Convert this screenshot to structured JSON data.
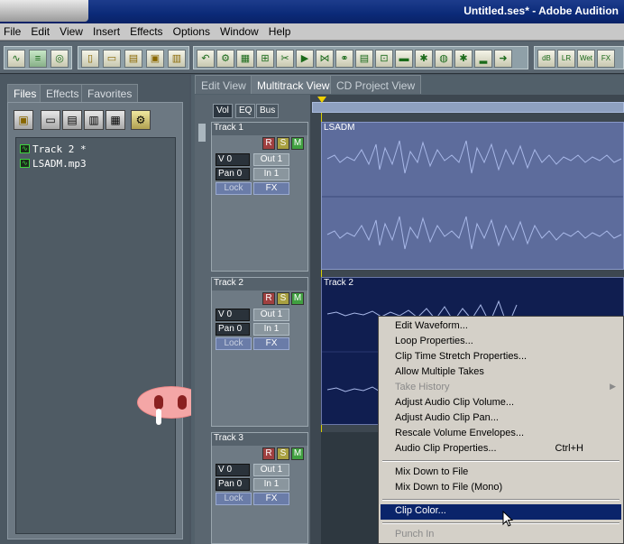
{
  "window": {
    "title": "Untitled.ses* - Adobe Audition"
  },
  "menubar": {
    "items": [
      "File",
      "Edit",
      "View",
      "Insert",
      "Effects",
      "Options",
      "Window",
      "Help"
    ]
  },
  "left_panel": {
    "tabs": [
      "Files",
      "Effects",
      "Favorites"
    ],
    "files": [
      "Track 2 *",
      "LSADM.mp3"
    ]
  },
  "view_tabs": [
    "Edit View",
    "Multitrack View",
    "CD Project View"
  ],
  "mixer_tabs": [
    "Vol",
    "EQ",
    "Bus"
  ],
  "tracks": [
    {
      "name": "Track 1",
      "r": "R",
      "s": "S",
      "m": "M",
      "vol": "V 0",
      "out": "Out 1",
      "pan": "Pan 0",
      "in": "In 1",
      "lock": "Lock",
      "fx": "FX",
      "clip": "LSADM"
    },
    {
      "name": "Track 2",
      "r": "R",
      "s": "S",
      "m": "M",
      "vol": "V 0",
      "out": "Out 1",
      "pan": "Pan 0",
      "in": "In 1",
      "lock": "Lock",
      "fx": "FX",
      "clip": "Track 2"
    },
    {
      "name": "Track 3",
      "r": "R",
      "s": "S",
      "m": "M",
      "vol": "V 0",
      "out": "Out 1",
      "pan": "Pan 0",
      "in": "In 1",
      "lock": "Lock",
      "fx": "FX"
    }
  ],
  "context_menu": {
    "items": [
      {
        "label": "Edit Waveform...",
        "state": "normal"
      },
      {
        "label": "Loop Properties...",
        "state": "normal"
      },
      {
        "label": "Clip Time Stretch Properties...",
        "state": "normal"
      },
      {
        "label": "Allow Multiple Takes",
        "state": "normal"
      },
      {
        "label": "Take History",
        "state": "disabled",
        "submenu": true
      },
      {
        "label": "Adjust Audio Clip Volume...",
        "state": "normal"
      },
      {
        "label": "Adjust Audio Clip Pan...",
        "state": "normal"
      },
      {
        "label": "Rescale Volume Envelopes...",
        "state": "normal"
      },
      {
        "label": "Audio Clip Properties...",
        "state": "normal",
        "shortcut": "Ctrl+H"
      },
      {
        "label": "Mix Down to File",
        "state": "normal"
      },
      {
        "label": "Mix Down to File (Mono)",
        "state": "normal"
      },
      {
        "label": "Clip Color...",
        "state": "highlight"
      },
      {
        "label": "Punch In",
        "state": "disabled"
      }
    ]
  },
  "colors": {
    "titlebar": "#0b2a78",
    "menu_highlight": "#0a246a",
    "clip_track1": "#5d6c9c",
    "clip_track2": "#101e50",
    "waveform": "#a8b8e8"
  }
}
